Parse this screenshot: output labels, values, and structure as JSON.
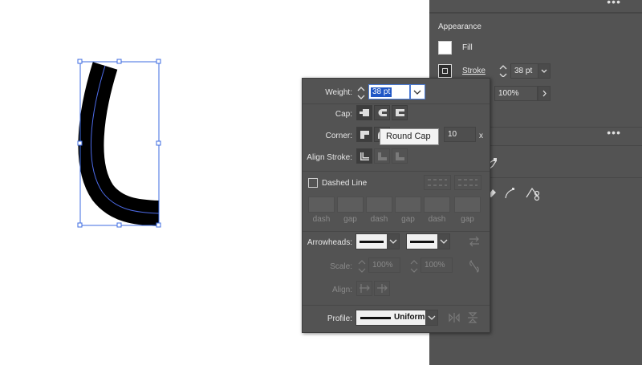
{
  "appearance_panel": {
    "title": "Appearance",
    "fill_label": "Fill",
    "stroke_label": "Stroke",
    "stroke_weight": "38 pt",
    "opacity": "100%",
    "menu_dots": "•••"
  },
  "stroke_popup": {
    "weight_label": "Weight:",
    "weight_value": "38 pt",
    "cap_label": "Cap:",
    "corner_label": "Corner:",
    "limit_value": "10",
    "limit_unit": "x",
    "align_stroke_label": "Align Stroke:",
    "dashed_line_label": "Dashed Line",
    "dash_gap_labels": [
      "dash",
      "gap",
      "dash",
      "gap",
      "dash",
      "gap"
    ],
    "arrowheads_label": "Arrowheads:",
    "scale_label": "Scale:",
    "scale_start": "100%",
    "scale_end": "100%",
    "align_label": "Align:",
    "profile_label": "Profile:",
    "profile_value": "Uniform"
  },
  "tooltip": {
    "text": "Round Cap"
  },
  "colors": {
    "panel_bg": "#535353",
    "selection_blue": "#3d5ee0",
    "highlight_blue": "#1f56c6",
    "canvas_bg": "#ffffff",
    "stroke_path": "#000000"
  }
}
